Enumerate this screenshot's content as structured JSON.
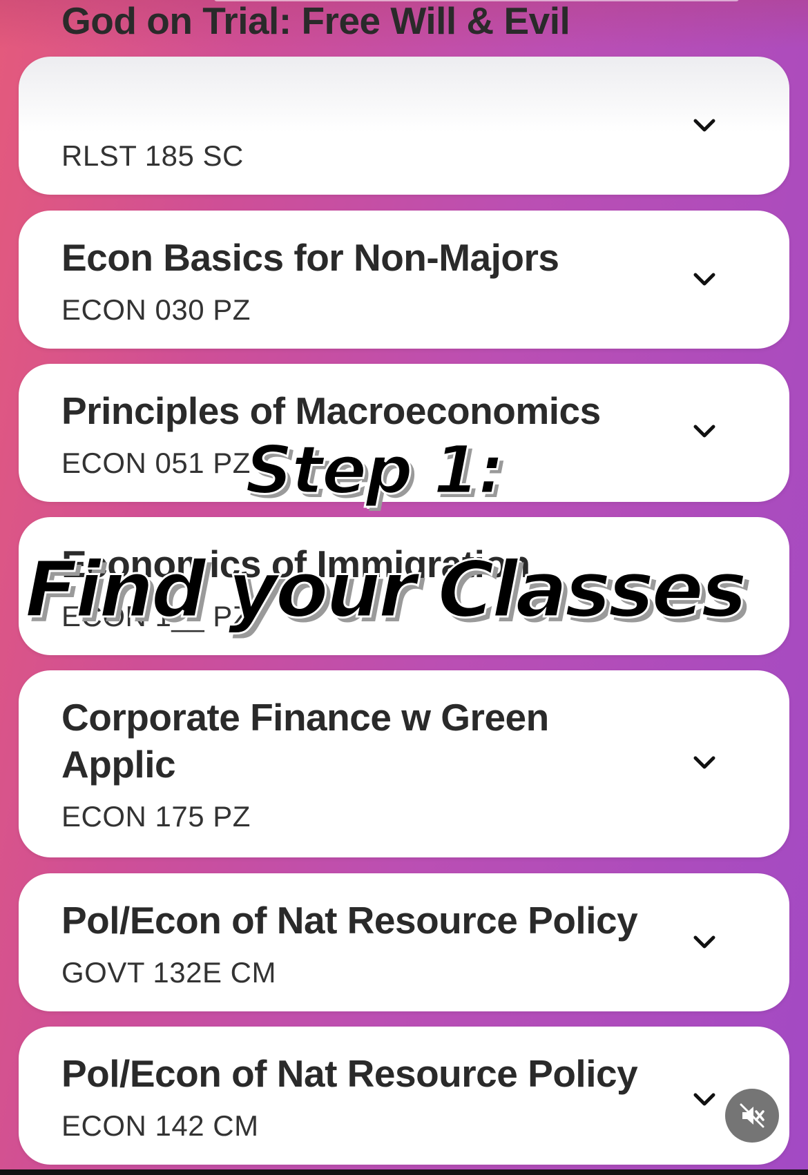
{
  "courses": [
    {
      "title": "God on Trial: Free Will & Evil",
      "code": "RLST 185 SC"
    },
    {
      "title": "Econ Basics for Non-Majors",
      "code": "ECON 030 PZ"
    },
    {
      "title": "Principles of Macroeconomics",
      "code": "ECON 051 PZ"
    },
    {
      "title": "Economics of Immigration",
      "code": "ECON 1__ PZ"
    },
    {
      "title": "Corporate Finance w Green Applic",
      "code": "ECON 175 PZ"
    },
    {
      "title": "Pol/Econ of Nat Resource Policy",
      "code": "GOVT 132E CM"
    },
    {
      "title": "Pol/Econ of Nat Resource Policy",
      "code": "ECON 142 CM"
    }
  ],
  "overlay": {
    "step": "Step 1:",
    "subtitle": "Find your Classes"
  },
  "icons": {
    "chevron": "chevron-down-icon",
    "mute": "muted-speaker-icon"
  }
}
